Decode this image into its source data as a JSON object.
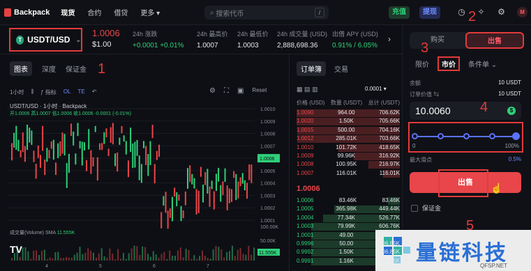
{
  "header": {
    "brand": "Backpack",
    "nav": [
      "现货",
      "合约",
      "借贷",
      "更多"
    ],
    "search_placeholder": "搜索代币",
    "search_key": "/",
    "deposit": "充值",
    "withdraw": "提现",
    "avatar": "M"
  },
  "ticker": {
    "pair": "USDT/USD",
    "price": "1.0006",
    "price_usd": "$1.00",
    "stats": [
      {
        "label": "24h 涨跌",
        "value": "+0.0001 +0.01%",
        "color": "green"
      },
      {
        "label": "24h 最高价",
        "value": "1.0007",
        "color": "white"
      },
      {
        "label": "24h 最低价",
        "value": "1.0003",
        "color": "white"
      },
      {
        "label": "24h 成交量 (USD)",
        "value": "2,888,698.36",
        "color": "white"
      },
      {
        "label": "出借 APY (USD)",
        "value": "0.91% / 6.05%",
        "color": "green"
      }
    ]
  },
  "left_tabs": [
    "图表",
    "深度",
    "保证金"
  ],
  "chart_toolbar": [
    "1小时",
    "指标",
    "OL",
    "TE",
    "Reset"
  ],
  "chart": {
    "title": "USDT/USD · 1小时 · Backpack",
    "ohlc": "开1.0006 高1.0007 低1.0006 收1.0006 -0.0001 (-0.01%)",
    "volume_label": "成交量(Volume) SMA",
    "volume_value": "11.555K",
    "y_ticks": [
      "1.0010",
      "1.0009",
      "1.0008",
      "1.0007",
      "1.0006",
      "1.0005",
      "1.0004",
      "1.0003",
      "1.0002",
      "1.0001"
    ],
    "current_price_tag": "1.0006",
    "x_ticks": [
      "4",
      "5",
      "6",
      "7"
    ],
    "vol_tag": "11.555K",
    "vol_ticks": [
      "100.00K",
      "50.00K"
    ]
  },
  "orderbook": {
    "tabs": [
      "订单簿",
      "交易"
    ],
    "precision": "0.0001",
    "headers": [
      "价格 (USD)",
      "数量 (USDT)",
      "总计 (USDT)"
    ],
    "asks": [
      [
        "1.0090",
        "964.00",
        "706.62K"
      ],
      [
        "1.0020",
        "1.50K",
        "705.66K"
      ],
      [
        "1.0015",
        "500.00",
        "704.16K"
      ],
      [
        "1.0012",
        "285.01K",
        "703.66K"
      ],
      [
        "1.0010",
        "101.72K",
        "418.65K"
      ],
      [
        "1.0009",
        "99.96K",
        "316.92K"
      ],
      [
        "1.0008",
        "100.95K",
        "216.97K"
      ],
      [
        "1.0007",
        "116.01K",
        "116.01K"
      ]
    ],
    "mid": "1.0006",
    "bids": [
      [
        "1.0006",
        "83.46K",
        "83.46K"
      ],
      [
        "1.0005",
        "365.98K",
        "449.44K"
      ],
      [
        "1.0004",
        "77.34K",
        "526.77K"
      ],
      [
        "1.0003",
        "79.99K",
        "606.76K"
      ],
      [
        "1.0001",
        "49.00",
        "606.80K"
      ],
      [
        "0.9996",
        "50.00",
        "606.85K"
      ],
      [
        "0.9992",
        "1.50K",
        "606.85K"
      ],
      [
        "0.9991",
        "1.16K",
        "606.85K"
      ]
    ]
  },
  "trade": {
    "buy": "购买",
    "sell": "出售",
    "types": [
      "限价",
      "市价",
      "条件单"
    ],
    "balance_label": "余额",
    "balance": "10 USDT",
    "order_value_label": "订单价值",
    "order_value": "10 USDT",
    "input_value": "10.0060",
    "slider_min": "0",
    "slider_max": "100%",
    "slider_fraction": 1.0,
    "slippage_label": "最大滑点",
    "slippage": "0.5%",
    "submit": "出售",
    "margin": "保证金"
  },
  "annotations": [
    "1",
    "2",
    "3",
    "4",
    "5"
  ],
  "watermark": {
    "title": "量链科技",
    "site": "QFSP.NET"
  }
}
